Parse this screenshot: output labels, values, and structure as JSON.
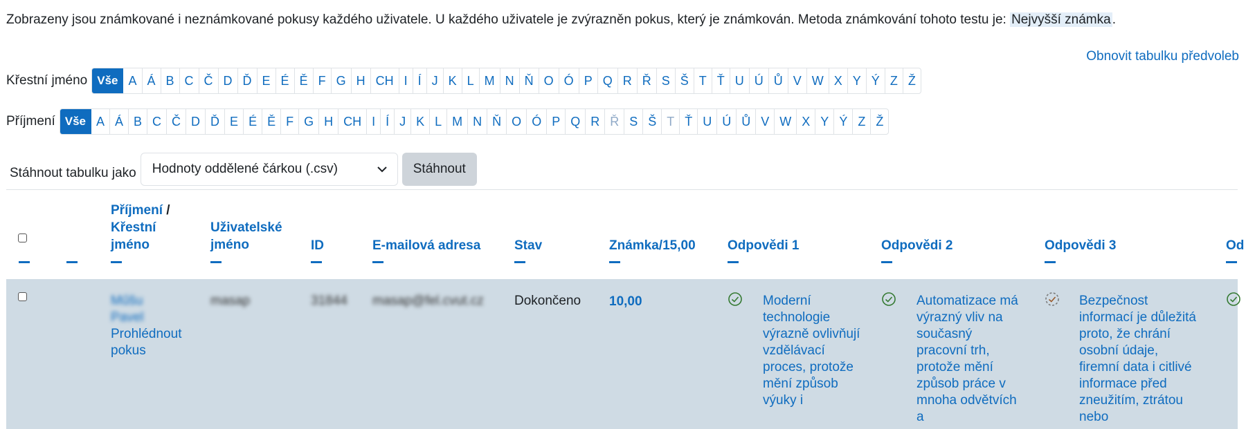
{
  "info": {
    "text": "Zobrazeny jsou známkované i neznámkované pokusy každého uživatele. U každého uživatele je zvýrazněn pokus, který je známkován. Metoda známkování tohoto testu je: ",
    "method": "Nejvyšší známka",
    "end": "."
  },
  "reset_label": "Obnovit tabulku předvoleb",
  "firstname": {
    "label": "Křestní jméno",
    "letters": [
      "Vše",
      "A",
      "Á",
      "B",
      "C",
      "Č",
      "D",
      "Ď",
      "E",
      "É",
      "Ě",
      "F",
      "G",
      "H",
      "CH",
      "I",
      "Í",
      "J",
      "K",
      "L",
      "M",
      "N",
      "Ň",
      "O",
      "Ó",
      "P",
      "Q",
      "R",
      "Ř",
      "S",
      "Š",
      "T",
      "Ť",
      "U",
      "Ú",
      "Ů",
      "V",
      "W",
      "X",
      "Y",
      "Ý",
      "Z",
      "Ž"
    ],
    "active": "Vše"
  },
  "lastname": {
    "label": "Příjmení",
    "letters": [
      "Vše",
      "A",
      "Á",
      "B",
      "C",
      "Č",
      "D",
      "Ď",
      "E",
      "É",
      "Ě",
      "F",
      "G",
      "H",
      "CH",
      "I",
      "Í",
      "J",
      "K",
      "L",
      "M",
      "N",
      "Ň",
      "O",
      "Ó",
      "P",
      "Q",
      "R",
      "Ř",
      "S",
      "Š",
      "T",
      "Ť",
      "U",
      "Ú",
      "Ů",
      "V",
      "W",
      "X",
      "Y",
      "Ý",
      "Z",
      "Ž"
    ],
    "active": "Vše",
    "dim": [
      "Ř",
      "T"
    ]
  },
  "download": {
    "label": "Stáhnout tabulku jako",
    "format": "Hodnoty oddělené čárkou (.csv)",
    "button": "Stáhnout"
  },
  "table": {
    "headers": {
      "name_a": "Příjmení",
      "name_sep": " /",
      "name_b": "Křestní jméno",
      "username": "Uživatelské jméno",
      "id": "ID",
      "email": "E-mailová adresa",
      "state": "Stav",
      "grade": "Známka/15,00",
      "r1": "Odpovědi 1",
      "r2": "Odpovědi 2",
      "r3": "Odpovědi 3",
      "r4": "Od"
    },
    "row": {
      "name": "Műšu Pavel",
      "review": "Prohlédnout pokus",
      "username": "masap",
      "id": "31844",
      "email": "masap@fel.cvut.cz",
      "state": "Dokončeno",
      "grade": "10,00",
      "r1": "Moderní technologie výrazně ovlivňují vzdělávací proces, protože mění způsob výuky i",
      "r2": "Automatizace má výrazný vliv na současný pracovní trh, protože mění způsob práce v mnoha odvětvích a",
      "r3": "Bezpečnost informací je důležitá proto, že chrání osobní údaje, firemní data i citlivé informace před zneužitím, ztrátou nebo"
    }
  },
  "colors": {
    "accent": "#0f6cbf",
    "row_bg": "#cfdbe4",
    "correct": "#357a32",
    "pending": "#7a7a7a"
  }
}
